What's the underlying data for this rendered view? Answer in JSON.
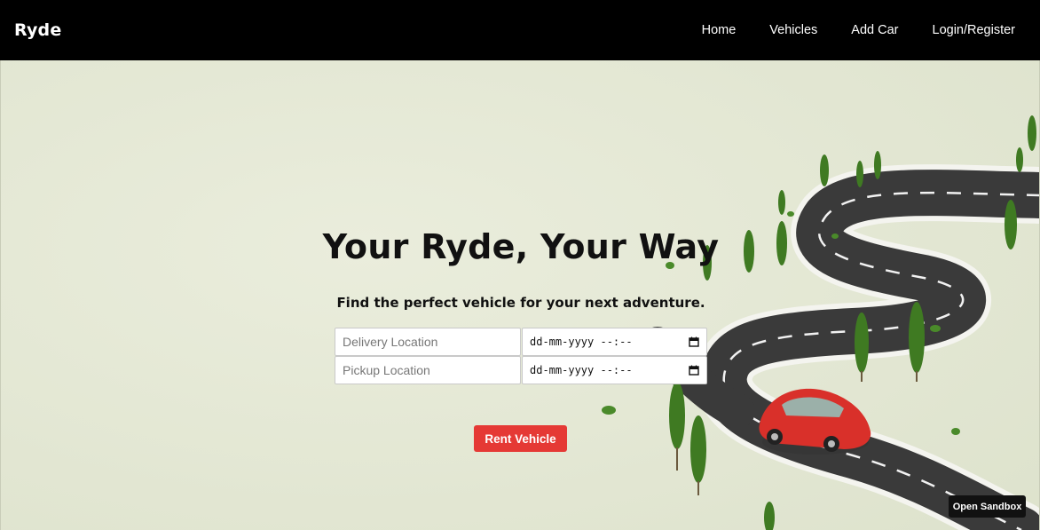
{
  "nav": {
    "brand": "Ryde",
    "links": [
      "Home",
      "Vehicles",
      "Add Car",
      "Login/Register"
    ]
  },
  "hero": {
    "title": "Your Ryde, Your Way",
    "subtitle": "Find the perfect vehicle for your next adventure.",
    "delivery_placeholder": "Delivery Location",
    "pickup_placeholder": "Pickup Location",
    "delivery_datetime": "dd-mm-yyyy  --:--",
    "pickup_datetime": "dd-mm-yyyy  --:--",
    "rent_button": "Rent Vehicle"
  },
  "sandbox": {
    "label": "Open Sandbox"
  },
  "colors": {
    "navbar": "#000000",
    "hero_bg": "#e6ead8",
    "road": "#3a3a3a",
    "car": "#d9302a",
    "tree": "#3f7a22",
    "rent_button": "#e53935"
  },
  "icons": [
    "calendar-icon",
    "calendar-icon"
  ]
}
